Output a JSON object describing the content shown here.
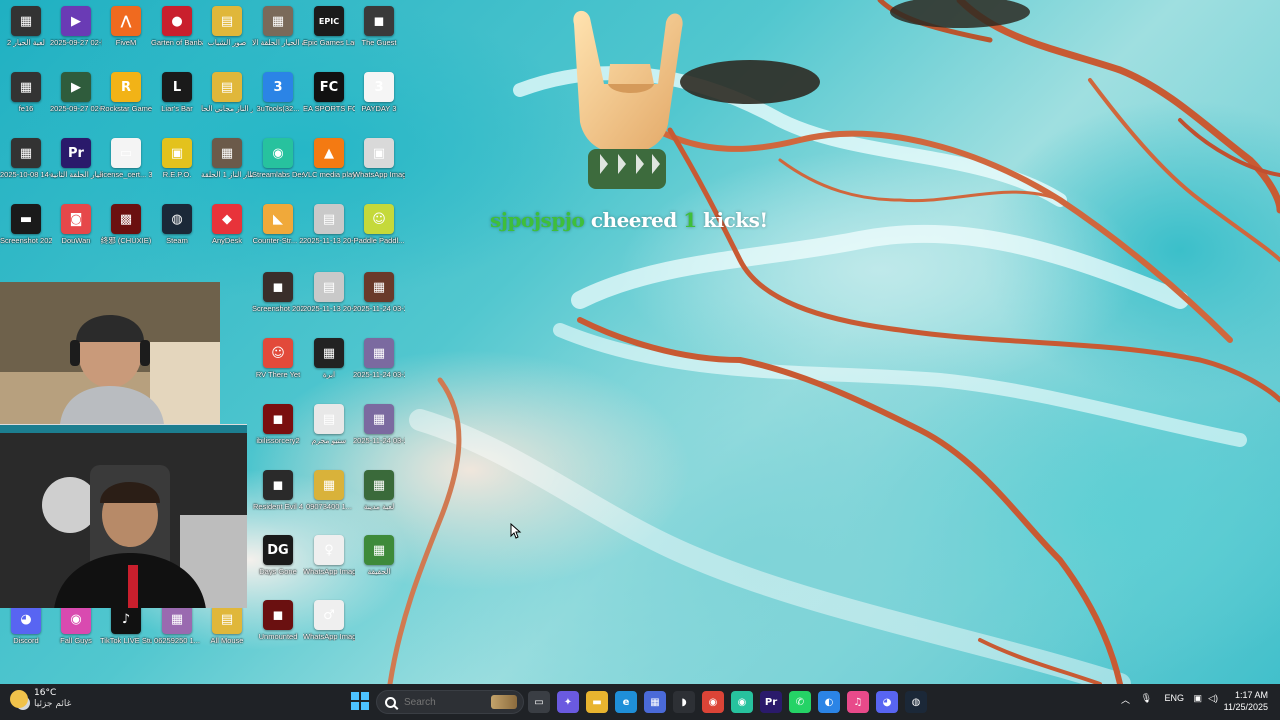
{
  "desktop": {
    "icons": [
      {
        "label": "لعبة الحيار 2",
        "glyph": "▦",
        "color": "#333"
      },
      {
        "label": "2025-09-27 02-54-23.00",
        "glyph": "▶",
        "color": "#6a3bb5"
      },
      {
        "label": "FiveM",
        "glyph": "⋀",
        "color": "#f06a1f"
      },
      {
        "label": "Garten of Banban 0",
        "glyph": "●",
        "color": "#c91f2d"
      },
      {
        "label": "صور الشباب",
        "glyph": "▤",
        "color": "#e0b73a"
      },
      {
        "label": "لعبة الحيار الحلقة الا...",
        "glyph": "▦",
        "color": "#7a6a5a"
      },
      {
        "label": "Epic Games Launcher",
        "glyph": "EPIC",
        "color": "#1b1b1b"
      },
      {
        "label": "The Guest",
        "glyph": "◼",
        "color": "#3a3a3a"
      },
      {
        "label": "fe16",
        "glyph": "▦",
        "color": "#333"
      },
      {
        "label": "2025-09-27 02-54-23.00...",
        "glyph": "▶",
        "color": "#2f5c3c"
      },
      {
        "label": "Rockstar Games ...",
        "glyph": "R",
        "color": "#f2b317"
      },
      {
        "label": "Liar's Bar",
        "glyph": "L",
        "color": "#1a1a1a"
      },
      {
        "label": "انتظار الناز مجاني الحا",
        "glyph": "▤",
        "color": "#e0b73a"
      },
      {
        "label": "3uTools(32...",
        "glyph": "3",
        "color": "#2b84e6"
      },
      {
        "label": "EA SPORTS FC 26",
        "glyph": "FC",
        "color": "#111"
      },
      {
        "label": "PAYDAY 3",
        "glyph": "3",
        "color": "#f5f5f5"
      },
      {
        "label": "2025-10-08 14-12-07",
        "glyph": "▦",
        "color": "#333"
      },
      {
        "label": "لعبة الحيار الحلقة الثانية",
        "glyph": "Pr",
        "color": "#2a1a6b"
      },
      {
        "label": "license_cert... 3",
        "glyph": "▭",
        "color": "#f4f4f4"
      },
      {
        "label": "R.E.P.O.",
        "glyph": "▣",
        "color": "#e3c21d"
      },
      {
        "label": "انتظار الناز 1 الحلقة",
        "glyph": "▦",
        "color": "#6b5a4a"
      },
      {
        "label": "Streamlabs Desktop",
        "glyph": "◉",
        "color": "#27c29e"
      },
      {
        "label": "VLC media player",
        "glyph": "▲",
        "color": "#f47a12"
      },
      {
        "label": "WhatsApp Image 2025...",
        "glyph": "▣",
        "color": "#d9d9d9"
      },
      {
        "label": "Screenshot 2025-10-...",
        "glyph": "▬",
        "color": "#1a1a1a"
      },
      {
        "label": "DouWan",
        "glyph": "◙",
        "color": "#e6484a"
      },
      {
        "label": "终邪 (CHUXIE)",
        "glyph": "▩",
        "color": "#6b1010"
      },
      {
        "label": "Steam",
        "glyph": "◍",
        "color": "#1b2838"
      },
      {
        "label": "AnyDesk",
        "glyph": "◆",
        "color": "#e8333a"
      },
      {
        "label": "Counter-Str... 2",
        "glyph": "◣",
        "color": "#f0a93a"
      },
      {
        "label": "2025-11-13 20-53-14.00...",
        "glyph": "▤",
        "color": "#c9c9c9"
      },
      {
        "label": "Paddle Paddl...",
        "glyph": "☺",
        "color": "#c5d93a"
      },
      {
        "label": "Screenshot 2025-11-...",
        "glyph": "◼",
        "color": "#3a2e2a"
      },
      {
        "label": "2025-11-13 20-53-14.00...",
        "glyph": "▤",
        "color": "#c9c9c9"
      },
      {
        "label": "2025-11-24 03-24-12.00...",
        "glyph": "▦",
        "color": "#6a3a2a"
      },
      {
        "label": "RV There Yet",
        "glyph": "☺",
        "color": "#e24a3a"
      },
      {
        "label": "ابرة",
        "glyph": "▦",
        "color": "#222"
      },
      {
        "label": "2025-11-24 03-24-12.00...",
        "glyph": "▦",
        "color": "#7b6aa0"
      },
      {
        "label": "ibilissorcery2",
        "glyph": "◼",
        "color": "#7a0f0f"
      },
      {
        "label": "ستيو مجرم",
        "glyph": "▤",
        "color": "#e8e8e8"
      },
      {
        "label": "2025-11-24 03-24-12.00...",
        "glyph": "▦",
        "color": "#7b6aa0"
      },
      {
        "label": "Resident Evil 4",
        "glyph": "◼",
        "color": "#2a2a2a"
      },
      {
        "label": "09073400 1...",
        "glyph": "▦",
        "color": "#d9b23a"
      },
      {
        "label": "لعبة مدينة",
        "glyph": "▦",
        "color": "#3a6a3a"
      },
      {
        "label": "Days Gone",
        "glyph": "DG",
        "color": "#1a1a1a"
      },
      {
        "label": "WhatsApp Image 2025...",
        "glyph": "♀",
        "color": "#efefef"
      },
      {
        "label": "الحقيقة",
        "glyph": "▦",
        "color": "#3e8a3a"
      },
      {
        "label": "Unmounted",
        "glyph": "◼",
        "color": "#6a1010"
      },
      {
        "label": "WhatsApp Image 2025...",
        "glyph": "♂",
        "color": "#efefef"
      },
      {
        "label": "Discord",
        "glyph": "◕",
        "color": "#5865f2"
      },
      {
        "label": "Fall Guys",
        "glyph": "◉",
        "color": "#d94ab0"
      },
      {
        "label": "TikTok LIVE Studio",
        "glyph": "♪",
        "color": "#111"
      },
      {
        "label": "06259250 1...",
        "glyph": "▦",
        "color": "#9a6ab0"
      },
      {
        "label": "All Mouse",
        "glyph": "▤",
        "color": "#e0b73a"
      }
    ]
  },
  "alert": {
    "username": "sjpojspjo",
    "middle": " cheered ",
    "amount": "1",
    "suffix": " kicks!"
  },
  "taskbar": {
    "weather_temp": "16°C",
    "weather_desc": "غائم جزئيا",
    "search_placeholder": "Search",
    "pinned_apps": [
      {
        "name": "Task View",
        "glyph": "▭",
        "color": "#3a3e44"
      },
      {
        "name": "Copilot",
        "glyph": "✦",
        "color": "#6a5ae0"
      },
      {
        "name": "File Explorer",
        "glyph": "▬",
        "color": "#e8b42f"
      },
      {
        "name": "Microsoft Edge",
        "glyph": "e",
        "color": "#1f8fd8"
      },
      {
        "name": "Microsoft Store",
        "glyph": "▦",
        "color": "#4a6ad8"
      },
      {
        "name": "Ghost App",
        "glyph": "◗",
        "color": "#2d3035"
      },
      {
        "name": "Google Chrome",
        "glyph": "◉",
        "color": "#db4437"
      },
      {
        "name": "Streamlabs",
        "glyph": "◉",
        "color": "#27c29e"
      },
      {
        "name": "Premiere Pro",
        "glyph": "Pr",
        "color": "#2a1a6b"
      },
      {
        "name": "WhatsApp",
        "glyph": "✆",
        "color": "#25d366"
      },
      {
        "name": "Browser",
        "glyph": "◐",
        "color": "#2b84e6"
      },
      {
        "name": "iTunes",
        "glyph": "♫",
        "color": "#e84a8a"
      },
      {
        "name": "Discord",
        "glyph": "◕",
        "color": "#5865f2"
      },
      {
        "name": "Steam",
        "glyph": "◍",
        "color": "#1b2838"
      }
    ],
    "language": "ENG",
    "time": "1:17 AM",
    "date": "11/25/2025"
  }
}
